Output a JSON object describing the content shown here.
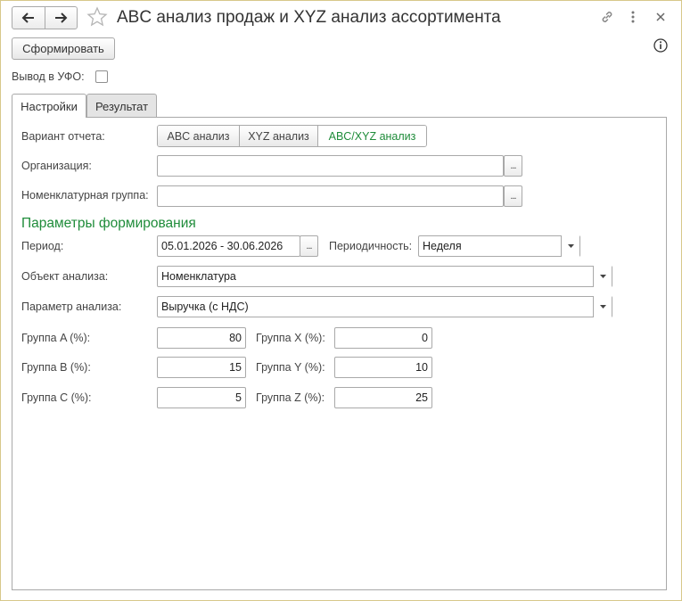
{
  "window": {
    "title": "ABC анализ продаж и XYZ анализ ассортимента"
  },
  "toolbar": {
    "generate_label": "Сформировать"
  },
  "options": {
    "ufo_label": "Вывод в УФО:",
    "ufo_checked": false
  },
  "tabs": [
    {
      "label": "Настройки",
      "active": true
    },
    {
      "label": "Результат",
      "active": false
    }
  ],
  "settings": {
    "variant_label": "Вариант отчета:",
    "variants": [
      "ABC анализ",
      "XYZ анализ",
      "ABC/XYZ анализ"
    ],
    "selected_variant": "ABC/XYZ анализ",
    "organization_label": "Организация:",
    "organization_value": "",
    "nomenclature_group_label": "Номенклатурная группа:",
    "nomenclature_group_value": "",
    "section_title": "Параметры формирования",
    "period_label": "Период:",
    "period_value": "05.01.2026 - 30.06.2026",
    "periodicity_label": "Периодичность:",
    "periodicity_value": "Неделя",
    "object_label": "Объект анализа:",
    "object_value": "Номенклатура",
    "parameter_label": "Параметр анализа:",
    "parameter_value": "Выручка (с НДС)",
    "groups_abc": [
      {
        "label": "Группа A (%):",
        "value": "80"
      },
      {
        "label": "Группа B (%):",
        "value": "15"
      },
      {
        "label": "Группа C (%):",
        "value": "5"
      }
    ],
    "groups_xyz": [
      {
        "label": "Группа X (%):",
        "value": "0"
      },
      {
        "label": "Группа Y (%):",
        "value": "10"
      },
      {
        "label": "Группа Z (%):",
        "value": "25"
      }
    ],
    "dots_label": "..."
  },
  "colors": {
    "accent_green": "#1f8c3a",
    "window_border": "#d7c88a"
  },
  "icons": {
    "back": "arrow-left-icon",
    "forward": "arrow-right-icon",
    "favorite": "star-icon",
    "link": "link-icon",
    "more": "more-vertical-icon",
    "close": "close-icon",
    "info": "info-icon"
  }
}
